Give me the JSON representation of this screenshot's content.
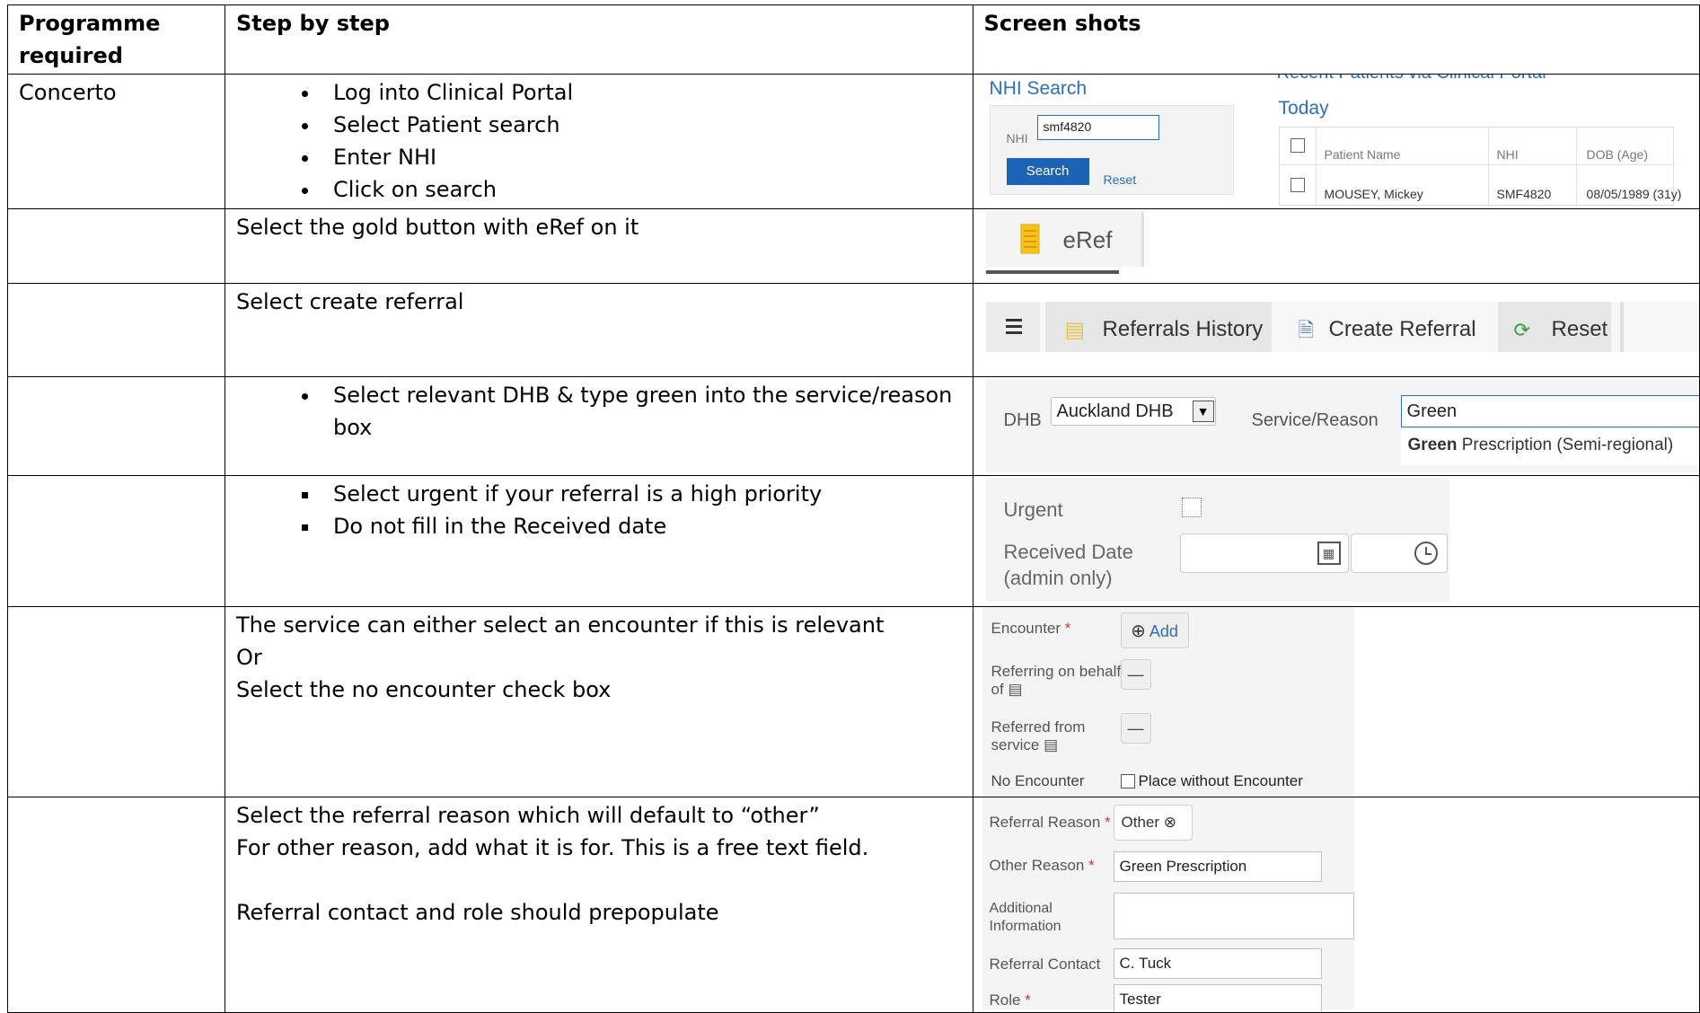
{
  "headers": {
    "programme": "Programme required",
    "steps": "Step by step",
    "screens": "Screen shots"
  },
  "rows": {
    "r1": {
      "programme": "Concerto",
      "steps": [
        "Log into Clinical Portal",
        "Select Patient search",
        "Enter NHI",
        "Click on search"
      ]
    },
    "r2": {
      "step": "Select the gold button with eRef on it"
    },
    "r3": {
      "step": "Select create referral"
    },
    "r4": {
      "step": "Select relevant DHB & type green into the service/reason box"
    },
    "r5": {
      "steps": [
        "Select urgent if your referral  is a high priority",
        "Do not fill in the Received date"
      ]
    },
    "r6": {
      "lines": [
        "The service can either select an encounter if this is relevant",
        "Or",
        "Select the no encounter check box"
      ]
    },
    "r7": {
      "lines": [
        "Select the referral reason which will default to “other”",
        "For other reason, add what it is for. This is a free text field.",
        "Referral contact and role should prepopulate"
      ]
    }
  },
  "shot1": {
    "nhi_search_title": "NHI Search",
    "nhi_label": "NHI",
    "nhi_value": "smf4820",
    "search_btn": "Search",
    "reset_link": "Reset",
    "recent_title": "Recent Patients via Clinical Portal",
    "today": "Today",
    "col_name": "Patient Name",
    "col_nhi": "NHI",
    "col_dob": "DOB (Age)",
    "patient_name": "MOUSEY, Mickey",
    "patient_nhi": "SMF4820",
    "patient_dob": "08/05/1989 (31y)"
  },
  "shot2": {
    "eref": "eRef"
  },
  "shot3": {
    "history": "Referrals History",
    "create": "Create Referral",
    "reset": "Reset"
  },
  "shot4": {
    "dhb_label": "DHB",
    "dhb_value": "Auckland DHB",
    "service_label": "Service/Reason",
    "service_value": "Green",
    "suggest_bold": "Green",
    "suggest_rest": " Prescription (Semi-regional)"
  },
  "shot5": {
    "urgent": "Urgent",
    "received_1": "Received Date",
    "received_2": "(admin only)"
  },
  "shot6": {
    "encounter": "Encounter",
    "add": "Add",
    "behalf_1": "Referring on behalf",
    "behalf_2": "of",
    "from_1": "Referred from",
    "from_2": "service",
    "dash": "—",
    "no_encounter": "No Encounter",
    "place_without": "Place without Encounter"
  },
  "shot7": {
    "reason": "Referral Reason",
    "reason_value": "Other",
    "other": "Other Reason",
    "other_value": "Green Prescription",
    "additional_1": "Additional",
    "additional_2": "Information",
    "contact": "Referral Contact",
    "contact_value": "C. Tuck",
    "role": "Role",
    "role_value": "Tester"
  }
}
